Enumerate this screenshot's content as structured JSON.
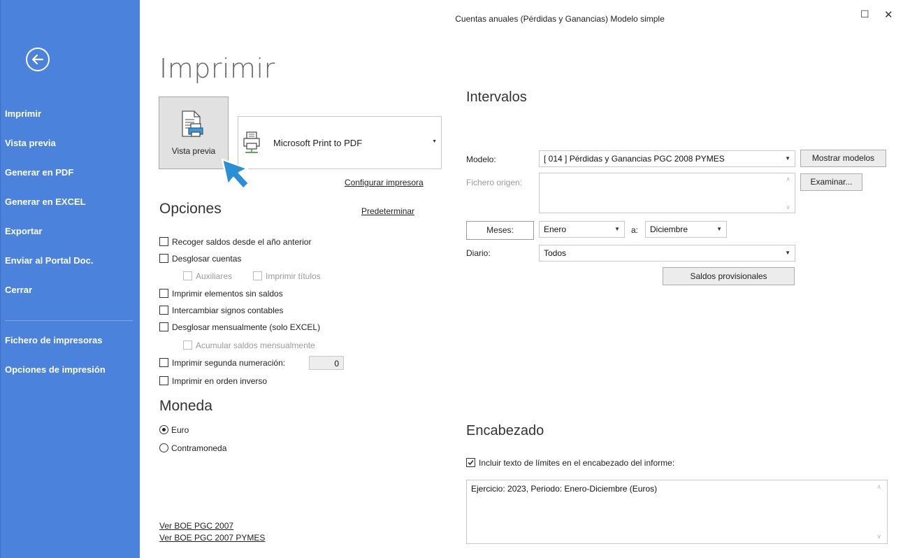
{
  "window": {
    "title": "Cuentas anuales (Pérdidas y Ganancias) Modelo simple",
    "maximize_glyph": "☐",
    "close_glyph": "✕"
  },
  "sidebar": {
    "back_icon": "arrow-left-circle-icon",
    "items": [
      {
        "label": "Imprimir"
      },
      {
        "label": "Vista previa"
      },
      {
        "label": "Generar en PDF"
      },
      {
        "label": "Generar en EXCEL"
      },
      {
        "label": "Exportar"
      },
      {
        "label": "Enviar al Portal Doc."
      },
      {
        "label": "Cerrar"
      },
      {
        "label": "Fichero de impresoras"
      },
      {
        "label": "Opciones de impresión"
      }
    ]
  },
  "main": {
    "page_title": "Imprimir",
    "preview_button": {
      "label": "Vista previa",
      "icon": "document-printer-icon"
    },
    "printer": {
      "name": "Microsoft Print to PDF",
      "icon": "printer-icon",
      "configure_link": "Configurar impresora"
    },
    "options": {
      "title": "Opciones",
      "default_link": "Predeterminar",
      "items": [
        {
          "label": "Recoger saldos desde el año anterior",
          "checked": false
        },
        {
          "label": "Desglosar cuentas",
          "checked": false
        },
        {
          "label": "Auxiliares",
          "checked": false,
          "disabled": true
        },
        {
          "label": "Imprimir títulos",
          "checked": false,
          "disabled": true
        },
        {
          "label": "Imprimir elementos sin saldos",
          "checked": false
        },
        {
          "label": "Intercambiar signos contables",
          "checked": false
        },
        {
          "label": "Desglosar mensualmente (solo EXCEL)",
          "checked": false
        },
        {
          "label": "Acumular saldos mensualmente",
          "checked": false,
          "disabled": true
        },
        {
          "label": "Imprimir segunda numeración:",
          "checked": false,
          "value": "0"
        },
        {
          "label": "Imprimir en orden inverso",
          "checked": false
        }
      ]
    },
    "currency": {
      "title": "Moneda",
      "options": [
        {
          "label": "Euro",
          "selected": true
        },
        {
          "label": "Contramoneda",
          "selected": false
        }
      ]
    },
    "footer_links": [
      "Ver BOE PGC 2007",
      "Ver BOE PGC 2007 PYMES"
    ],
    "intervals": {
      "title": "Intervalos",
      "model_label": "Modelo:",
      "model_value": "[ 014 ] Pérdidas y Ganancias PGC 2008 PYMES",
      "show_models_button": "Mostrar modelos",
      "source_file_label": "Fichero origen:",
      "source_file_value": "",
      "browse_button": "Examinar...",
      "months_button": "Meses:",
      "month_from": "Enero",
      "month_to_label": "a:",
      "month_to": "Diciembre",
      "journal_label": "Diario:",
      "journal_value": "Todos",
      "provisional_button": "Saldos provisionales"
    },
    "header": {
      "title": "Encabezado",
      "include_label": "Incluir texto de límites en el encabezado del informe:",
      "include_checked": true,
      "text": "Ejercicio: 2023, Periodo: Enero-Diciembre (Euros)"
    }
  },
  "colors": {
    "sidebar": "#4a82dc",
    "cursor_arrow": "#2b8fd6"
  }
}
